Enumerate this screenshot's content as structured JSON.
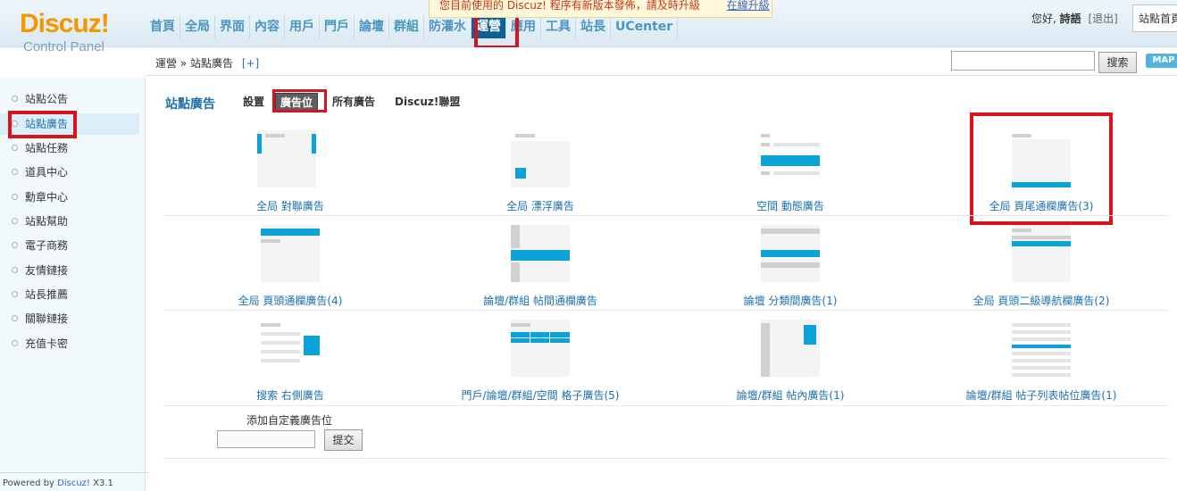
{
  "logo": {
    "title": "Discuz!",
    "subtitle": "Control Panel"
  },
  "nav": [
    "首頁",
    "全局",
    "界面",
    "內容",
    "用戶",
    "門戶",
    "論壇",
    "群組",
    "防灌水",
    "運營",
    "應用",
    "工具",
    "站長",
    "UCenter"
  ],
  "nav_active": "運營",
  "notice": {
    "text": "您目前使用的 Discuz! 程序有新版本發佈，請及時升級",
    "link": "在線升級"
  },
  "user": {
    "greeting": "您好,",
    "name": "詩語",
    "logout": "[退出]",
    "site_home": "站點首頁"
  },
  "breadcrumb": {
    "text": "運營 » 站點廣告",
    "plus": "[+]"
  },
  "search": {
    "button": "搜索",
    "map": "MAP"
  },
  "sidebar": [
    "站點公告",
    "站點廣告",
    "站點任務",
    "道具中心",
    "勳章中心",
    "站點幫助",
    "電子商務",
    "友情鏈接",
    "站長推薦",
    "關聯鏈接",
    "充值卡密"
  ],
  "sidebar_active": "站點廣告",
  "powered": {
    "prefix": "Powered by ",
    "brand": "Discuz!",
    "version": " X3.1"
  },
  "page": {
    "title": "站點廣告",
    "tabs": [
      "設置",
      "廣告位",
      "所有廣告",
      "Discuz!聯盟"
    ],
    "active_tab": "廣告位"
  },
  "ad_positions": [
    "全局 對聯廣告",
    "全局 漂浮廣告",
    "空間 動態廣告",
    "全局 頁尾通欄廣告(3)",
    "全局 頁頭通欄廣告(4)",
    "論壇/群組 帖間通欄廣告",
    "論壇 分類間廣告(1)",
    "全局 頁頭二級導航欄廣告(2)",
    "搜索 右側廣告",
    "門戶/論壇/群組/空間 格子廣告(5)",
    "論壇/群組 帖內廣告(1)",
    "論壇/群組 帖子列表帖位廣告(1)"
  ],
  "custom": {
    "label": "添加自定義廣告位",
    "button": "提交"
  },
  "colors": {
    "accent": "#1e71ab",
    "thumb_blue": "#0aa2d8",
    "highlight": "#d7131e",
    "nav_active_bg": "#0f5f99"
  }
}
